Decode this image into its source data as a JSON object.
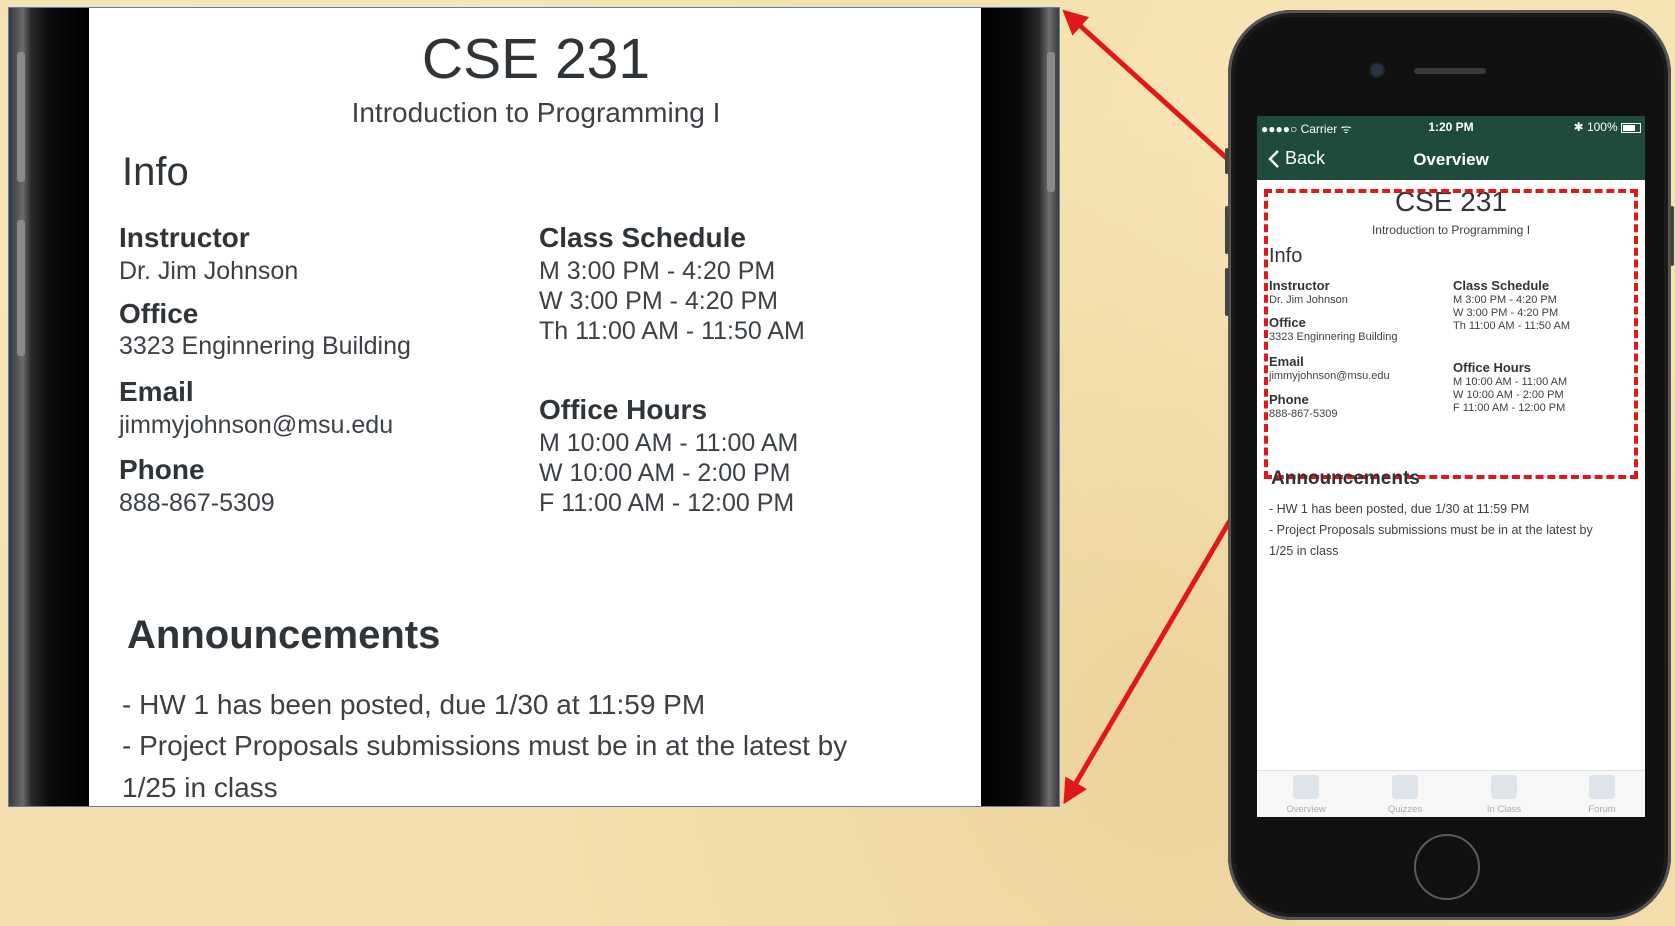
{
  "course": {
    "code": "CSE 231",
    "name": "Introduction to Programming I"
  },
  "info": {
    "heading": "Info",
    "instructor_label": "Instructor",
    "instructor": "Dr. Jim Johnson",
    "office_label": "Office",
    "office": "3323 Enginnering Building",
    "email_label": "Email",
    "email": "jimmyjohnson@msu.edu",
    "phone_label": "Phone",
    "phone": "888-867-5309",
    "schedule_label": "Class Schedule",
    "schedule": [
      "M  3:00 PM - 4:20 PM",
      "W  3:00 PM - 4:20 PM",
      "Th  11:00 AM - 11:50 AM"
    ],
    "hours_label": "Office Hours",
    "hours": [
      "M 10:00 AM - 11:00 AM",
      "W 10:00 AM - 2:00 PM",
      " F  11:00 AM - 12:00 PM"
    ]
  },
  "announcements": {
    "heading": "Announcements",
    "lines": [
      "- HW 1 has been posted, due 1/30 at 11:59 PM",
      "- Project Proposals submissions must be in at the latest by",
      "1/25 in class"
    ]
  },
  "status_bar": {
    "carrier": "●●●●○ Carrier ᯤ",
    "time": "1:20 PM",
    "battery": "✱ 100%"
  },
  "nav": {
    "back_label": "Back",
    "title": "Overview"
  },
  "tabs": [
    {
      "label": "Overview",
      "icon": "overview-icon"
    },
    {
      "label": "Quizzes",
      "icon": "quizzes-icon"
    },
    {
      "label": "In Class",
      "icon": "in-class-icon"
    },
    {
      "label": "Forum",
      "icon": "forum-icon"
    }
  ],
  "colors": {
    "nav_green": "#1f4c3a",
    "highlight_red": "#e01818",
    "background": "#f3dfad"
  }
}
